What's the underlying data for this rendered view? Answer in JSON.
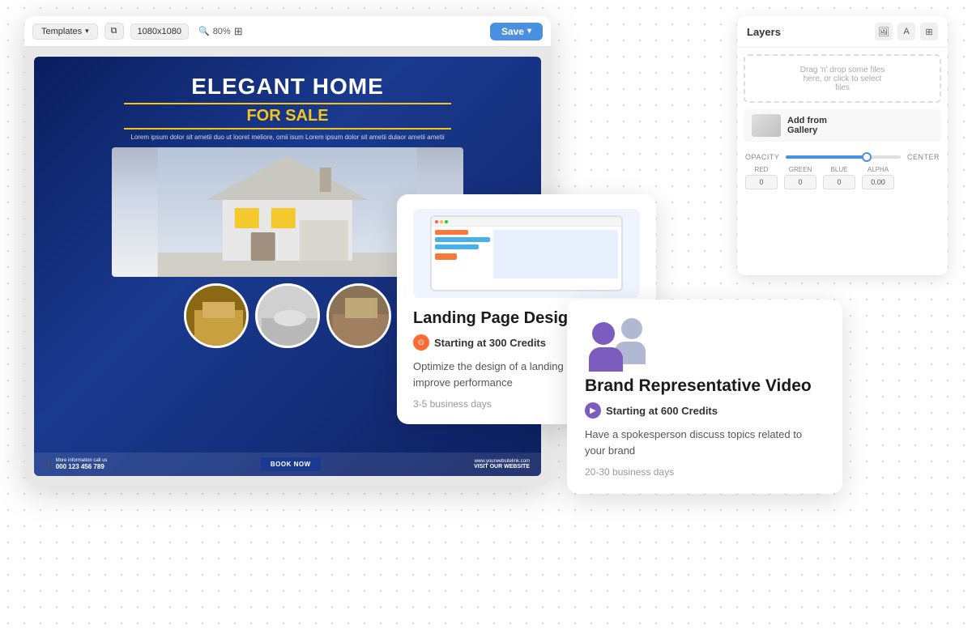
{
  "background": {
    "dotColor": "#cccccc"
  },
  "editor": {
    "toolbar": {
      "templates_label": "Templates",
      "size_label": "1080x1080",
      "zoom_label": "80%",
      "save_label": "Save"
    },
    "design": {
      "title_line1": "ELEGANT HOME",
      "title_line2": "FOR SALE",
      "lorem_text": "Lorem ipsum dolor sit ametii duo ut looret meliore, omii isum\nLorem ipsum dolor sit ametii dulaor ametii ametii",
      "phone_label": "More information call us",
      "phone_number": "000 123 456 789",
      "book_btn": "BOOK NOW",
      "website_label": "www.yourwebsitelink.com",
      "visit_label": "VISIT OUR WEBSITE"
    }
  },
  "layers_panel": {
    "title": "Layers",
    "dropzone_text": "Drag 'n' drop some files\nhere, or click to select\nfiles",
    "add_gallery_label": "Add from\nGallery",
    "opacity_label": "OPACITY",
    "center_label": "CENTER",
    "red_label": "RED",
    "green_label": "GREEN",
    "blue_label": "BLUE",
    "alpha_label": "ALPHA",
    "alpha_value": "0.00"
  },
  "landing_card": {
    "service_title": "Landing Page Design",
    "credits_text": "Starting at 300 Credits",
    "description": "Optimize the design of a landing page to improve performance",
    "duration": "3-5 business days"
  },
  "brand_card": {
    "service_title": "Brand Representative Video",
    "credits_text": "Starting at 600 Credits",
    "description": "Have a spokesperson discuss topics related to your brand",
    "duration": "20-30 business days"
  }
}
